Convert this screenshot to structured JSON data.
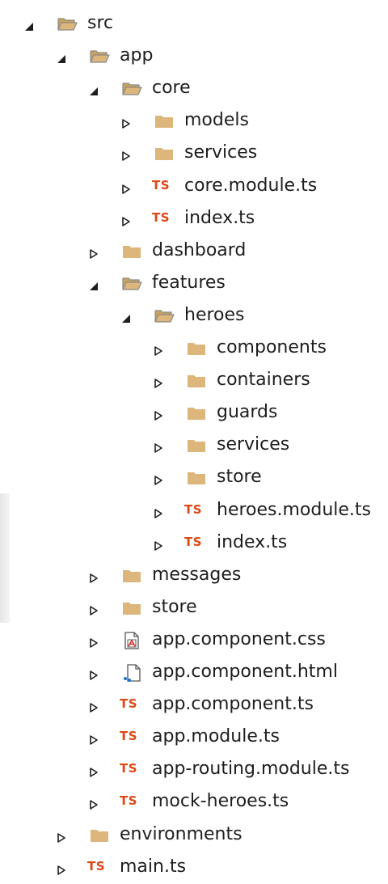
{
  "tree": [
    {
      "label": "src",
      "depth": 0,
      "kind": "folder-open",
      "expanded": true
    },
    {
      "label": "app",
      "depth": 1,
      "kind": "folder-open",
      "expanded": true
    },
    {
      "label": "core",
      "depth": 2,
      "kind": "folder-open",
      "expanded": true
    },
    {
      "label": "models",
      "depth": 3,
      "kind": "folder",
      "expanded": false
    },
    {
      "label": "services",
      "depth": 3,
      "kind": "folder",
      "expanded": false
    },
    {
      "label": "core.module.ts",
      "depth": 3,
      "kind": "ts",
      "expanded": false
    },
    {
      "label": "index.ts",
      "depth": 3,
      "kind": "ts",
      "expanded": false
    },
    {
      "label": "dashboard",
      "depth": 2,
      "kind": "folder",
      "expanded": false
    },
    {
      "label": "features",
      "depth": 2,
      "kind": "folder-open",
      "expanded": true
    },
    {
      "label": "heroes",
      "depth": 3,
      "kind": "folder-open",
      "expanded": true
    },
    {
      "label": "components",
      "depth": 4,
      "kind": "folder",
      "expanded": false
    },
    {
      "label": "containers",
      "depth": 4,
      "kind": "folder",
      "expanded": false
    },
    {
      "label": "guards",
      "depth": 4,
      "kind": "folder",
      "expanded": false
    },
    {
      "label": "services",
      "depth": 4,
      "kind": "folder",
      "expanded": false
    },
    {
      "label": "store",
      "depth": 4,
      "kind": "folder",
      "expanded": false
    },
    {
      "label": "heroes.module.ts",
      "depth": 4,
      "kind": "ts",
      "expanded": false
    },
    {
      "label": "index.ts",
      "depth": 4,
      "kind": "ts",
      "expanded": false
    },
    {
      "label": "messages",
      "depth": 2,
      "kind": "folder",
      "expanded": false
    },
    {
      "label": "store",
      "depth": 2,
      "kind": "folder",
      "expanded": false
    },
    {
      "label": "app.component.css",
      "depth": 2,
      "kind": "css",
      "expanded": false
    },
    {
      "label": "app.component.html",
      "depth": 2,
      "kind": "html",
      "expanded": false
    },
    {
      "label": "app.component.ts",
      "depth": 2,
      "kind": "ts",
      "expanded": false
    },
    {
      "label": "app.module.ts",
      "depth": 2,
      "kind": "ts",
      "expanded": false
    },
    {
      "label": "app-routing.module.ts",
      "depth": 2,
      "kind": "ts",
      "expanded": false
    },
    {
      "label": "mock-heroes.ts",
      "depth": 2,
      "kind": "ts",
      "expanded": false
    },
    {
      "label": "environments",
      "depth": 1,
      "kind": "folder",
      "expanded": false
    },
    {
      "label": "main.ts",
      "depth": 1,
      "kind": "ts",
      "expanded": false
    }
  ],
  "icons": {
    "folder": "folder-icon",
    "folder-open": "folder-open-icon",
    "ts": "typescript-file-icon",
    "css": "css-file-icon",
    "html": "html-file-icon"
  },
  "ts_badge": "TS",
  "colors": {
    "folder": "#dcb67a",
    "folder_dark": "#c9a25e",
    "ts": "#dd4814",
    "text": "#1e1e1e",
    "chevron": "#1e1e1e"
  }
}
